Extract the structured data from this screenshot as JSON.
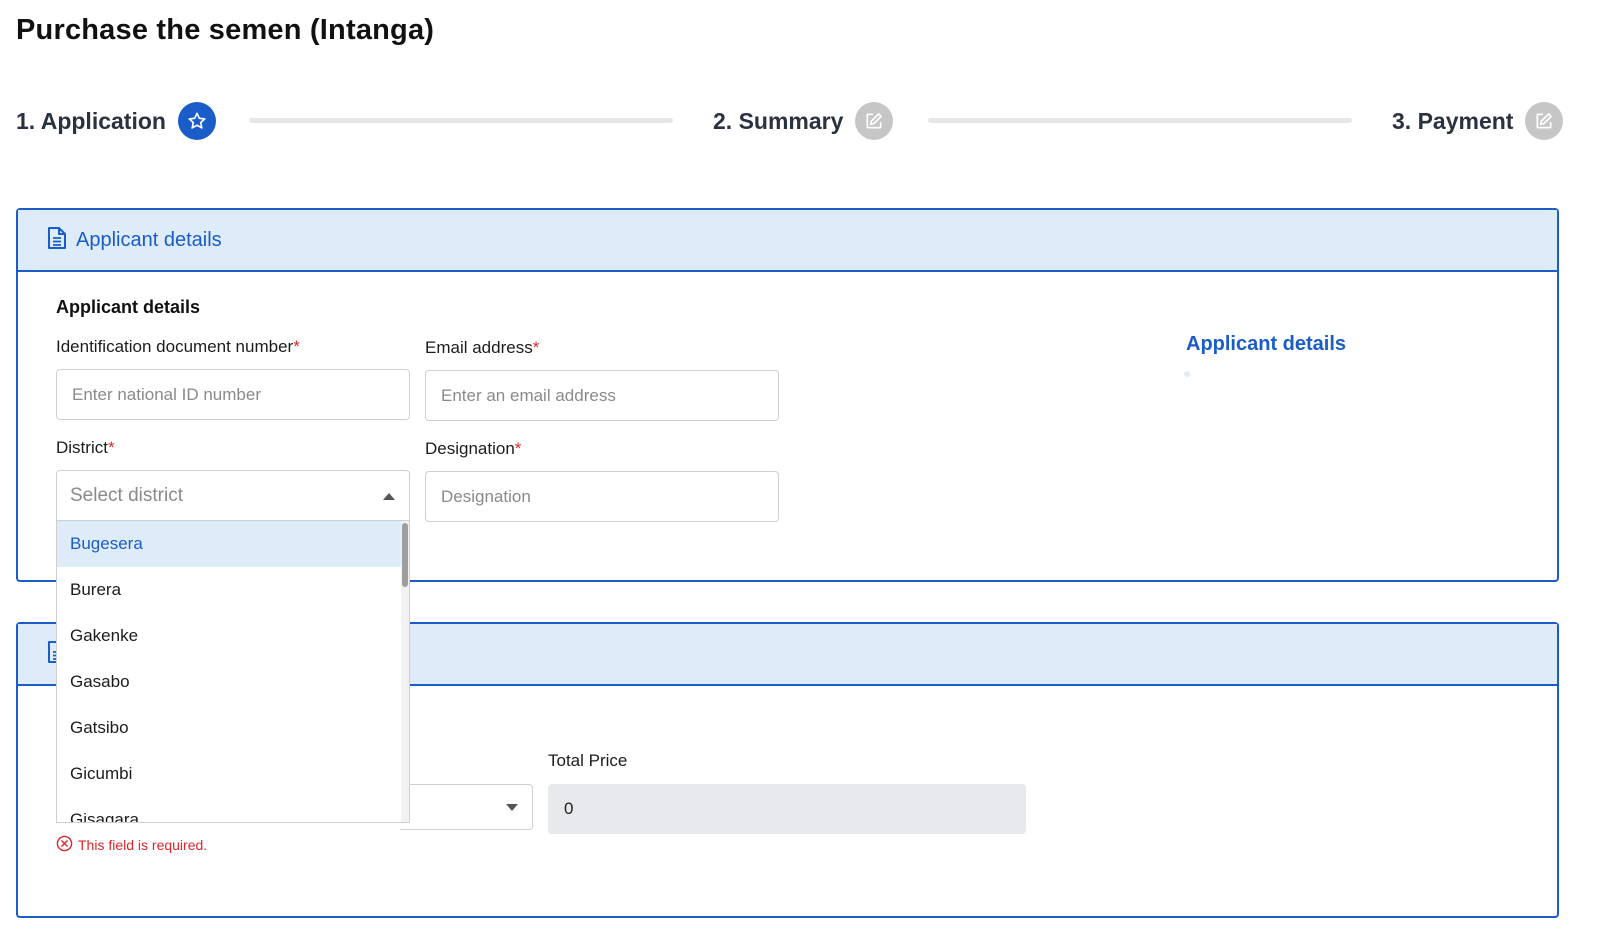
{
  "page": {
    "title": "Purchase the semen (Intanga)"
  },
  "stepper": {
    "steps": [
      {
        "label": "1. Application",
        "state": "active",
        "icon": "star-icon"
      },
      {
        "label": "2. Summary",
        "state": "inactive",
        "icon": "edit-icon"
      },
      {
        "label": "3. Payment",
        "state": "inactive",
        "icon": "edit-icon"
      }
    ]
  },
  "applicant_panel": {
    "header_title": "Applicant details",
    "section_title": "Applicant details",
    "id_number": {
      "label": "Identification document number",
      "required_mark": "*",
      "placeholder": "Enter national ID number",
      "value": ""
    },
    "email": {
      "label": "Email address",
      "required_mark": "*",
      "placeholder": "Enter an email address",
      "value": ""
    },
    "district": {
      "label": "District",
      "required_mark": "*",
      "placeholder": "Select district",
      "options": [
        "Bugesera",
        "Burera",
        "Gakenke",
        "Gasabo",
        "Gatsibo",
        "Gicumbi",
        "Gisagara"
      ],
      "highlighted": "Bugesera"
    },
    "designation": {
      "label": "Designation",
      "required_mark": "*",
      "placeholder": "Designation",
      "value": ""
    },
    "side_nav_link": "Applicant details"
  },
  "second_panel": {
    "total_price": {
      "label": "Total Price",
      "value": "0"
    },
    "error_message": "This field is required."
  },
  "colors": {
    "primary": "#1a5cc8",
    "header_bg": "#deebf8",
    "error": "#e0262b",
    "inactive_step": "#c6c6c6"
  }
}
